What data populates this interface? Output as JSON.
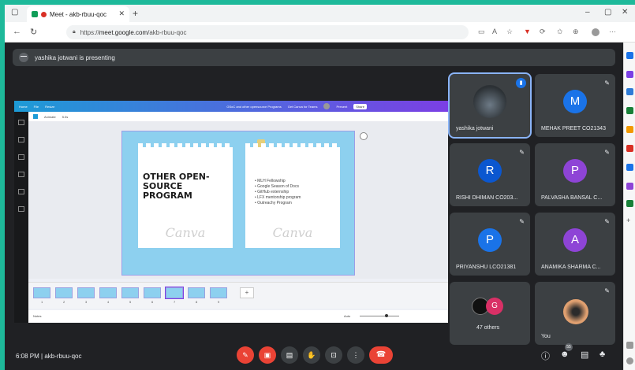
{
  "browser": {
    "tab_title": "Meet - akb-rbuu-qoc",
    "url_scheme": "https://",
    "url_host": "meet.google.com",
    "url_path": "/akb-rbuu-qoc"
  },
  "meet": {
    "presenting_text": "yashika jotwani is presenting",
    "time": "6:08 PM",
    "separator": "|",
    "meeting_code": "akb-rbuu-qoc",
    "people_count": "55"
  },
  "canva": {
    "top_menu": [
      "Home",
      "File",
      "Resize"
    ],
    "doc_title": "GSoC and other opensource Programs",
    "try_pro": "Get Canva for Teams",
    "present_label": "Present",
    "share_label": "Share",
    "sub_animate": "Animate",
    "sub_duration": "5.0s",
    "side_labels": [
      "Design",
      "Elements",
      "Uploads",
      "Text",
      "Projects",
      "Apps"
    ],
    "slide_title_lines": [
      "OTHER OPEN-",
      "SOURCE",
      "PROGRAM"
    ],
    "watermark": "Canva",
    "bullets": [
      "MLH Fellowship",
      "Google Season of Docs",
      "GitHub externship",
      "LFX mentorship program",
      "Outreachy Program"
    ],
    "pages": [
      "1",
      "2",
      "3",
      "4",
      "5",
      "6",
      "7",
      "8",
      "9"
    ],
    "add_page": "+",
    "notes_label": "Notes",
    "zoom_label": "Auto"
  },
  "participants": [
    {
      "name": "yashika jotwani",
      "initial": "",
      "color": "",
      "photo": true,
      "speaking": true
    },
    {
      "name": "MEHAK PREET CO21343",
      "initial": "M",
      "color": "#1a73e8"
    },
    {
      "name": "RISHI DHIMAN CO203...",
      "initial": "R",
      "color": "#0b57d0"
    },
    {
      "name": "PALVASHA BANSAL C...",
      "initial": "P",
      "color": "#8e44d6"
    },
    {
      "name": "PRIYANSHU LCO21381",
      "initial": "P",
      "color": "#1a73e8"
    },
    {
      "name": "ANAMIKA SHARMA C...",
      "initial": "A",
      "color": "#8e44d6"
    },
    {
      "name": "47 others",
      "initial": "G",
      "color": "#d93066"
    },
    {
      "name": "You",
      "initial": "",
      "color": "",
      "photo": true
    }
  ]
}
